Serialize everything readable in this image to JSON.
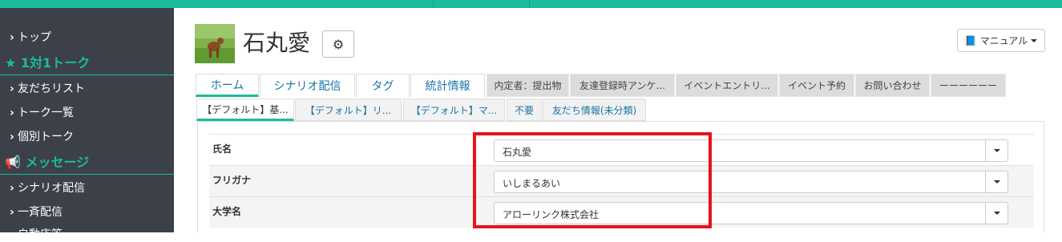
{
  "sidebar": {
    "items": [
      {
        "label": "トップ",
        "type": "item"
      },
      {
        "label": "1対1トーク",
        "type": "heading",
        "icon": "star-icon"
      },
      {
        "label": "友だちリスト",
        "type": "item"
      },
      {
        "label": "トーク一覧",
        "type": "item"
      },
      {
        "label": "個別トーク",
        "type": "item"
      },
      {
        "label": "メッセージ",
        "type": "heading",
        "icon": "megaphone-icon"
      },
      {
        "label": "シナリオ配信",
        "type": "item"
      },
      {
        "label": "一斉配信",
        "type": "item"
      },
      {
        "label": "自動応答",
        "type": "item"
      }
    ]
  },
  "header": {
    "name": "石丸愛",
    "manual_label": "マニュアル"
  },
  "main_tabs": [
    {
      "label": "ホーム",
      "active": true
    },
    {
      "label": "シナリオ配信"
    },
    {
      "label": "タグ"
    },
    {
      "label": "統計情報"
    }
  ],
  "gray_tabs": [
    {
      "label": "内定者：提出物"
    },
    {
      "label": "友達登録時アンケ..."
    },
    {
      "label": "イベントエントリ..."
    },
    {
      "label": "イベント予約"
    },
    {
      "label": "お問い合わせ"
    },
    {
      "label": "ーーーーーー"
    }
  ],
  "sub_tabs": [
    {
      "label": "【デフォルト】基...",
      "active": true
    },
    {
      "label": "【デフォルト】リ..."
    },
    {
      "label": "【デフォルト】マ..."
    },
    {
      "label": "不要"
    },
    {
      "label": "友だち情報(未分類)"
    }
  ],
  "fields": [
    {
      "label": "氏名",
      "value": "石丸愛"
    },
    {
      "label": "フリガナ",
      "value": "いしまるあい"
    },
    {
      "label": "大学名",
      "value": "アローリンク株式会社"
    }
  ],
  "colors": {
    "accent": "#1bbc9b",
    "sidebar": "#3c4049",
    "highlight": "#e8121a",
    "link": "#1a73a8"
  }
}
